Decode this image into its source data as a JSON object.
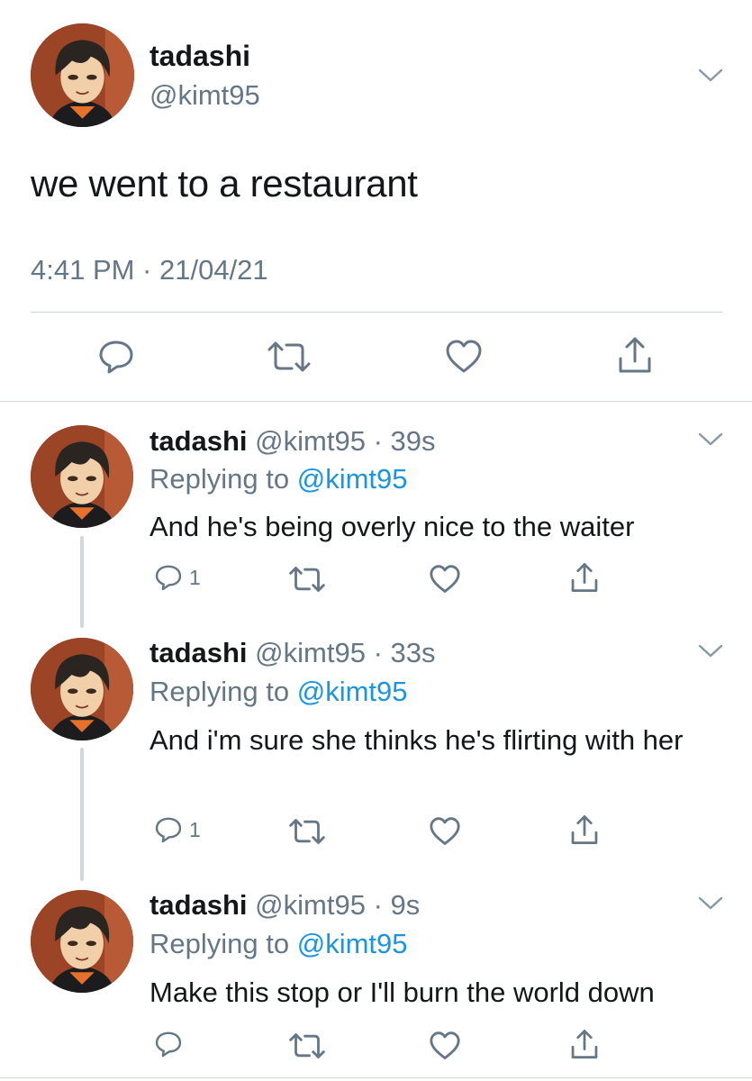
{
  "main_tweet": {
    "name": "tadashi",
    "handle": "@kimt95",
    "text": "we went to a restaurant",
    "meta": "4:41 PM · 21/04/21"
  },
  "replies": [
    {
      "name": "tadashi",
      "handle": "@kimt95",
      "age": "· 39s",
      "replying_prefix": "Replying to",
      "replying_to": "@kimt95",
      "text": "And he's being overly nice to the waiter",
      "reply_count": "1"
    },
    {
      "name": "tadashi",
      "handle": "@kimt95",
      "age": "· 33s",
      "replying_prefix": "Replying to",
      "replying_to": "@kimt95",
      "text": "And i'm sure she thinks he's flirting with her",
      "reply_count": "1"
    },
    {
      "name": "tadashi",
      "handle": "@kimt95",
      "age": "· 9s",
      "replying_prefix": "Replying to",
      "replying_to": "@kimt95",
      "text": "Make this stop or I'll burn the world down",
      "reply_count": ""
    }
  ],
  "icons": {
    "reply": "reply-icon",
    "retweet": "retweet-icon",
    "like": "heart-icon",
    "share": "share-icon",
    "more": "chevron-down-icon"
  },
  "colors": {
    "text": "#14171a",
    "secondary": "#657786",
    "mention": "#1b95e0",
    "divider": "#cfd5da",
    "avatar_bg": "#8f3d22"
  }
}
